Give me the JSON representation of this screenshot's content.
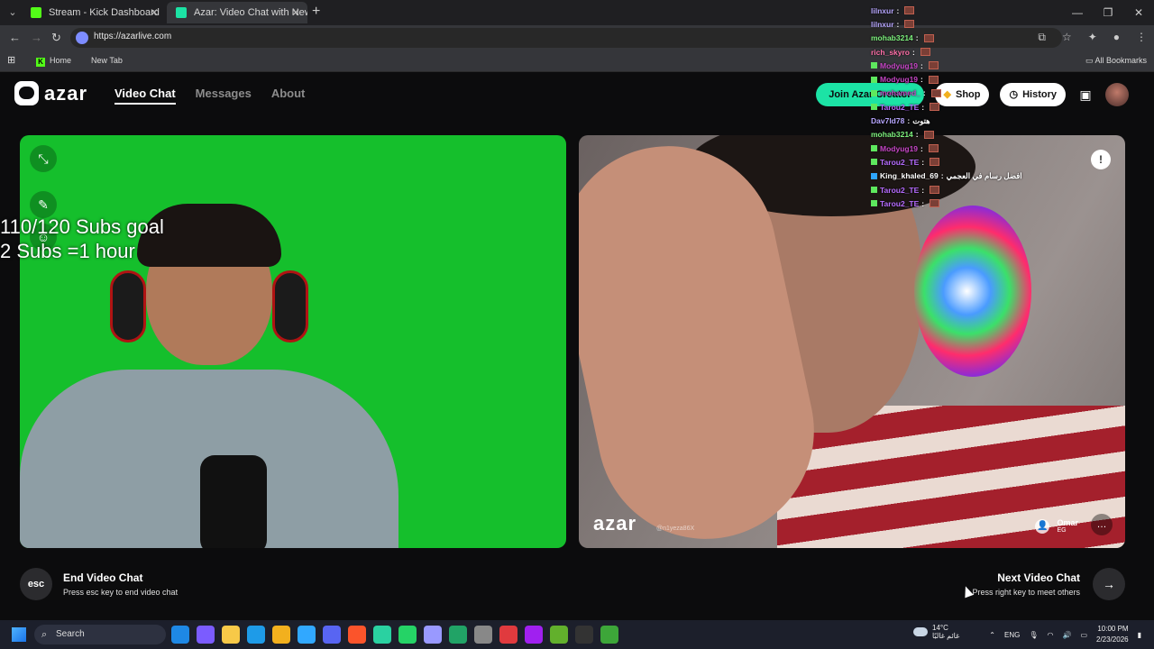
{
  "browser": {
    "tabs": [
      {
        "label": "Stream - Kick Dashboard",
        "favicon_color": "#53fc18"
      },
      {
        "label": "Azar: Video Chat with New",
        "favicon_color": "#1ce3a5"
      }
    ],
    "url": "https://azarlive.com",
    "bookmarks": [
      "Home",
      "New Tab"
    ],
    "all_bookmarks": "All Bookmarks"
  },
  "site": {
    "logo": "azar",
    "nav": [
      "Video Chat",
      "Messages",
      "About"
    ],
    "buttons": {
      "creator": "Join Azar Creator",
      "shop": "Shop",
      "history": "History"
    }
  },
  "overlay": {
    "goal_line1": "110/120 Subs goal",
    "goal_line2": "2 Subs =1 hour"
  },
  "peer": {
    "watermark": "azar",
    "watermark_id": "@n1yeza86X",
    "name": "Omar",
    "country": "EG"
  },
  "controls": {
    "end_title": "End Video Chat",
    "end_sub": "Press esc key to end video chat",
    "esc_label": "esc",
    "next_title": "Next Video Chat",
    "next_sub": "Press right key to meet others"
  },
  "chat": [
    {
      "user": "lilnxur",
      "msg": "",
      "color": "#b7a6ff"
    },
    {
      "user": "lilnxur",
      "msg": "",
      "color": "#b7a6ff"
    },
    {
      "user": "mohab3214",
      "msg": "",
      "color": "#7cf07c"
    },
    {
      "user": "rich_skyro",
      "msg": "",
      "color": "#ff6fa8"
    },
    {
      "user": "Modyug19",
      "msg": "",
      "color": "#c445c4"
    },
    {
      "user": "Modyug19",
      "msg": "",
      "color": "#c445c4"
    },
    {
      "user": "mohamed_",
      "msg": "",
      "color": "#c445c4"
    },
    {
      "user": "Tarou2_TE",
      "msg": "",
      "color": "#b56bff"
    },
    {
      "user": "Dav7ld78",
      "msg": "هتوت",
      "color": "#b7a6ff"
    },
    {
      "user": "mohab3214",
      "msg": "",
      "color": "#7cf07c"
    },
    {
      "user": "Modyug19",
      "msg": "",
      "color": "#c445c4"
    },
    {
      "user": "Tarou2_TE",
      "msg": "",
      "color": "#b56bff"
    },
    {
      "user": "King_khaled_69",
      "msg": "افضل رسام في العجمي",
      "color": "#ffffff"
    },
    {
      "user": "Tarou2_TE",
      "msg": "",
      "color": "#b56bff"
    },
    {
      "user": "Tarou2_TE",
      "msg": "",
      "color": "#b56bff"
    }
  ],
  "taskbar": {
    "search": "Search",
    "weather_temp": "14°C",
    "weather_desc": "غائم غالبًا",
    "lang": "ENG",
    "time": "10:00 PM",
    "date": "2/23/2026",
    "apps": [
      "#1e88e5",
      "#7b5cff",
      "#f7c948",
      "#1e9be8",
      "#f2b01e",
      "#31a8ff",
      "#5865f2",
      "#fb542b",
      "#2ad1a1",
      "#25d366",
      "#9999ff",
      "#21a366",
      "#888",
      "#e03a3e",
      "#a020f0",
      "#62b02c",
      "#333",
      "#3da639"
    ]
  }
}
